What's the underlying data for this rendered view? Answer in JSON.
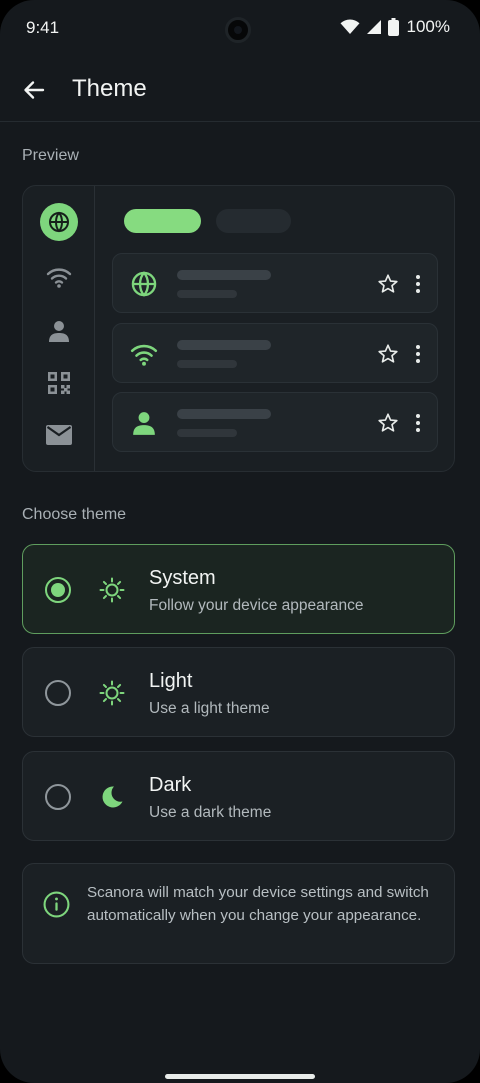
{
  "status_bar": {
    "time": "9:41",
    "battery": "100%"
  },
  "app_bar": {
    "title": "Theme",
    "back_icon": "arrow-left-icon"
  },
  "preview": {
    "label": "Preview",
    "rail_icons": [
      "globe-icon",
      "wifi-icon",
      "person-icon",
      "qr-code-icon",
      "mail-icon"
    ],
    "active_rail_index": 0,
    "cards": [
      {
        "icon": "globe-icon"
      },
      {
        "icon": "wifi-icon"
      },
      {
        "icon": "person-icon"
      }
    ]
  },
  "choose": {
    "label": "Choose theme",
    "options": [
      {
        "title": "System",
        "subtitle": "Follow your device appearance",
        "icon": "sun-icon",
        "selected": true
      },
      {
        "title": "Light",
        "subtitle": "Use a light theme",
        "icon": "sun-icon",
        "selected": false
      },
      {
        "title": "Dark",
        "subtitle": "Use a dark theme",
        "icon": "moon-icon",
        "selected": false
      }
    ]
  },
  "info": {
    "icon": "info-icon",
    "text": "Scanora will match your device settings and switch automatically when you change your appearance."
  },
  "colors": {
    "accent": "#7ed67d",
    "background": "#15191d",
    "surface": "#1b2024"
  }
}
